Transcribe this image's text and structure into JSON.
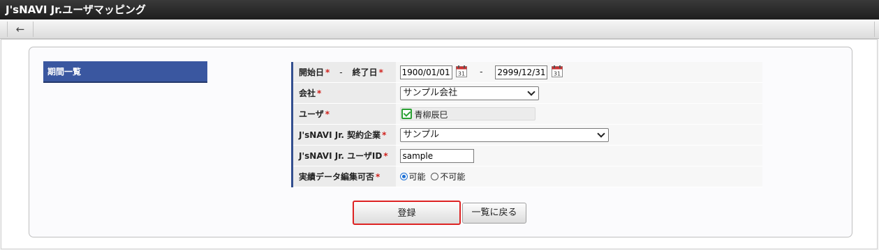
{
  "window": {
    "title": "J'sNAVI Jr.ユーザマッピング"
  },
  "toolbar": {
    "back_icon": "arrow-left-icon",
    "back_glyph": "←"
  },
  "sidebar": {
    "tab_label": "期間一覧"
  },
  "form": {
    "period": {
      "start_label": "開始日",
      "end_label": "終了日",
      "separator": "-",
      "start_value": "1900/01/01",
      "end_value": "2999/12/31",
      "calendar_day": "31"
    },
    "company": {
      "label": "会社",
      "value": "サンプル会社"
    },
    "user": {
      "label": "ユーザ",
      "value": "青柳辰巳"
    },
    "contract_company": {
      "label": "J'sNAVI Jr. 契約企業",
      "value": "サンプル"
    },
    "user_id": {
      "label": "J'sNAVI Jr. ユーザID",
      "value": "sample"
    },
    "edit_permission": {
      "label": "実績データ編集可否",
      "options": [
        "可能",
        "不可能"
      ],
      "selected": "可能"
    },
    "required_mark": "*"
  },
  "buttons": {
    "register": "登録",
    "back_to_list": "一覧に戻る"
  },
  "colors": {
    "accent": "#3a57a0",
    "required": "#d0211c",
    "highlight": "#dd2222"
  }
}
